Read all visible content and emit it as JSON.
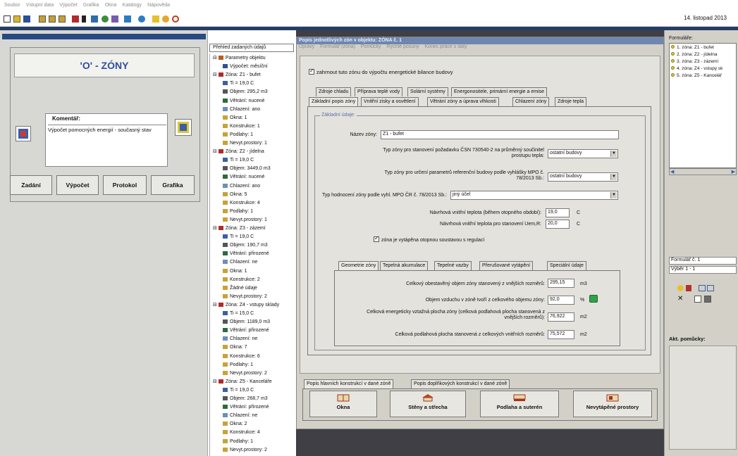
{
  "menubar": {
    "items": [
      "Soubor",
      "Vstupní data",
      "Výpočet",
      "Grafika",
      "Okna",
      "Katalogy",
      "Nápověda"
    ]
  },
  "toolbar": {
    "date": "14. listopad 2013"
  },
  "zones_panel": {
    "title": "'O' - ZÓNY",
    "comment_label": "Komentář:",
    "comment_text": "Výpočet pomocných energií - současný stav",
    "buttons": [
      "Zadání",
      "Výpočet",
      "Protokol",
      "Grafika"
    ]
  },
  "tree": {
    "header": "Přehled zadaných údajů",
    "nodes": [
      {
        "label": "Parametry objektu",
        "level": 0,
        "icon": "house-icon"
      },
      {
        "label": "Výpočet: měsíční",
        "level": 1,
        "icon": "calc-icon"
      },
      {
        "label": "Zóna: Z1 - bufet",
        "level": 0,
        "icon": "zone-icon"
      },
      {
        "label": "Ti = 19,0 C",
        "level": 1,
        "icon": "temp-icon"
      },
      {
        "label": "Objem: 295,2 m3",
        "level": 1,
        "icon": "volume-icon"
      },
      {
        "label": "Větrání: nucené",
        "level": 1,
        "icon": "vent-icon"
      },
      {
        "label": "Chlazení: ano",
        "level": 1,
        "icon": "snow-icon"
      },
      {
        "label": "Okna: 1",
        "level": 1,
        "icon": "folder-icon"
      },
      {
        "label": "Konstrukce: 1",
        "level": 1,
        "icon": "folder-icon"
      },
      {
        "label": "Podlahy: 1",
        "level": 1,
        "icon": "folder-icon"
      },
      {
        "label": "Nevyt.prostory: 1",
        "level": 1,
        "icon": "folder-icon"
      },
      {
        "label": "Zóna: Z2 - jídelna",
        "level": 0,
        "icon": "zone-icon"
      },
      {
        "label": "Ti = 19,0 C",
        "level": 1,
        "icon": "temp-icon"
      },
      {
        "label": "Objem: 3449,0 m3",
        "level": 1,
        "icon": "volume-icon"
      },
      {
        "label": "Větrání: nucené",
        "level": 1,
        "icon": "vent-icon"
      },
      {
        "label": "Chlazení: ano",
        "level": 1,
        "icon": "snow-icon"
      },
      {
        "label": "Okna: 5",
        "level": 1,
        "icon": "folder-icon"
      },
      {
        "label": "Konstrukce: 4",
        "level": 1,
        "icon": "folder-icon"
      },
      {
        "label": "Podlahy: 1",
        "level": 1,
        "icon": "folder-icon"
      },
      {
        "label": "Nevyt.prostory: 1",
        "level": 1,
        "icon": "folder-icon"
      },
      {
        "label": "Zóna: Z3 - zázemí",
        "level": 0,
        "icon": "zone-icon"
      },
      {
        "label": "Ti = 19,0 C",
        "level": 1,
        "icon": "temp-icon"
      },
      {
        "label": "Objem: 190,7 m3",
        "level": 1,
        "icon": "volume-icon"
      },
      {
        "label": "Větrání: přirozené",
        "level": 1,
        "icon": "vent-icon"
      },
      {
        "label": "Chlazení: ne",
        "level": 1,
        "icon": "snow-icon"
      },
      {
        "label": "Okna: 1",
        "level": 1,
        "icon": "folder-icon"
      },
      {
        "label": "Konstrukce: 2",
        "level": 1,
        "icon": "folder-icon"
      },
      {
        "label": "Žádné údaje",
        "level": 1,
        "icon": "folder-icon"
      },
      {
        "label": "Nevyt.prostory: 2",
        "level": 1,
        "icon": "folder-icon"
      },
      {
        "label": "Zóna: Z4 - vstupy sklady",
        "level": 0,
        "icon": "zone-icon"
      },
      {
        "label": "Ti = 15,0 C",
        "level": 1,
        "icon": "temp-icon"
      },
      {
        "label": "Objem: 1189,0 m3",
        "level": 1,
        "icon": "volume-icon"
      },
      {
        "label": "Větrání: přirozené",
        "level": 1,
        "icon": "vent-icon"
      },
      {
        "label": "Chlazení: ne",
        "level": 1,
        "icon": "snow-icon"
      },
      {
        "label": "Okna: 7",
        "level": 1,
        "icon": "folder-icon"
      },
      {
        "label": "Konstrukce: 6",
        "level": 1,
        "icon": "folder-icon"
      },
      {
        "label": "Podlahy: 1",
        "level": 1,
        "icon": "folder-icon"
      },
      {
        "label": "Nevyt.prostory: 2",
        "level": 1,
        "icon": "folder-icon"
      },
      {
        "label": "Zóna: Z5 - Kanceláře",
        "level": 0,
        "icon": "zone-icon"
      },
      {
        "label": "Ti = 19,0 C",
        "level": 1,
        "icon": "temp-icon"
      },
      {
        "label": "Objem: 268,7 m3",
        "level": 1,
        "icon": "volume-icon"
      },
      {
        "label": "Větrání: přirozené",
        "level": 1,
        "icon": "vent-icon"
      },
      {
        "label": "Chlazení: ne",
        "level": 1,
        "icon": "snow-icon"
      },
      {
        "label": "Okna: 2",
        "level": 1,
        "icon": "folder-icon"
      },
      {
        "label": "Konstrukce: 4",
        "level": 1,
        "icon": "folder-icon"
      },
      {
        "label": "Podlahy: 1",
        "level": 1,
        "icon": "folder-icon"
      },
      {
        "label": "Nevyt.prostory: 2",
        "level": 1,
        "icon": "folder-icon"
      }
    ]
  },
  "dialog": {
    "title": "Popis jednotlivých zón v objektu:  ZÓNA č. 1",
    "menu": [
      "Úpravy",
      "Formulář (zóna)",
      "Pomůcky",
      "Rychlé posuny",
      "Konec práce s daty"
    ],
    "include_checkbox": "zahrnout tuto zónu do výpočtu energetické bilance budovy",
    "tabs_row1": [
      "Zdroje chladu",
      "Příprava teplé vody",
      "Solární systémy",
      "Energonositele, primární energie a emise"
    ],
    "tabs_row2": [
      "Základní popis zóny",
      "Vnitřní zisky a osvětlení",
      "Větrání zóny a úprava vlhkosti",
      "Chlazení zóny",
      "Zdroje tepla"
    ],
    "group_title": "Základní údaje:",
    "zone_name_label": "Název zóny:",
    "zone_name_value": "Z1 - bufet",
    "type_req_label": "Typ zóny pro stanovení požadavku ČSN 730540-2 na průměrný součinitel prostupu tepla:",
    "type_req_value": "ostatní budovy",
    "type_ref_label": "Typ zóny pro určení parametrů referenční budovy podle vyhlášky MPO č. 78/2013 Sb.:",
    "type_ref_value": "ostatní budovy",
    "type_eval_label": "Typ hodnocení zóny podle vyhl. MPO ČR č. 78/2013 Sb.:",
    "type_eval_value": "jiný účel",
    "temp_design_label": "Návrhová vnitřní teplota (během otopného období):",
    "temp_design_value": "19,0",
    "temp_uem_label": "Návrhová vnitřní teplota pro stanovení Uem,R:",
    "temp_uem_value": "20,0",
    "unit_c": "C",
    "heated_checkbox": "zóna je vytápěna otopnou soustavou s regulací",
    "inner_tabs": [
      "Geometrie zóny",
      "Tepelná akumulace",
      "Tepelné vazby",
      "Přerušované vytápění",
      "Speciální údaje"
    ],
    "vol_label": "Celkový obestavěný objem zóny stanovený z vnějších rozměrů:",
    "vol_value": "295,15",
    "vol_unit": "m3",
    "air_label": "Objem vzduchu v zóně tvoří z celkového objemu zóny:",
    "air_value": "92,0",
    "air_unit": "%",
    "area_label": "Celková energeticky vztažná plocha zóny (celková podlahová plocha stanovená z vnějších rozměrů):",
    "area_value": "76,922",
    "area_unit": "m2",
    "floor_label": "Celková podlahová plocha stanovená z celkových vnitřních rozměrů:",
    "floor_value": "75,572",
    "floor_unit": "m2",
    "bottom_tabs": [
      "Popis hlavních konstrukcí v dané zóně",
      "Popis doplňkových konstrukcí v dané zóně"
    ],
    "bottom_buttons": [
      "Okna",
      "Stěny a střecha",
      "Podlaha a suterén",
      "Nevytápěné prostory"
    ]
  },
  "right_panel": {
    "forms_label": "Formuláře:",
    "forms": [
      "1. zóna: Z1 - bufet",
      "2. zóna: Z2 - jídelna",
      "3. zóna: Z3 - zázemí",
      "4. zóna: Z4 - vstupy sk",
      "5. zóna: Z5 - Kancelář"
    ],
    "form_no": "Formulář č. 1",
    "selection": "Výběr 1 - 1",
    "help_label": "Akt. pomůcky:"
  }
}
